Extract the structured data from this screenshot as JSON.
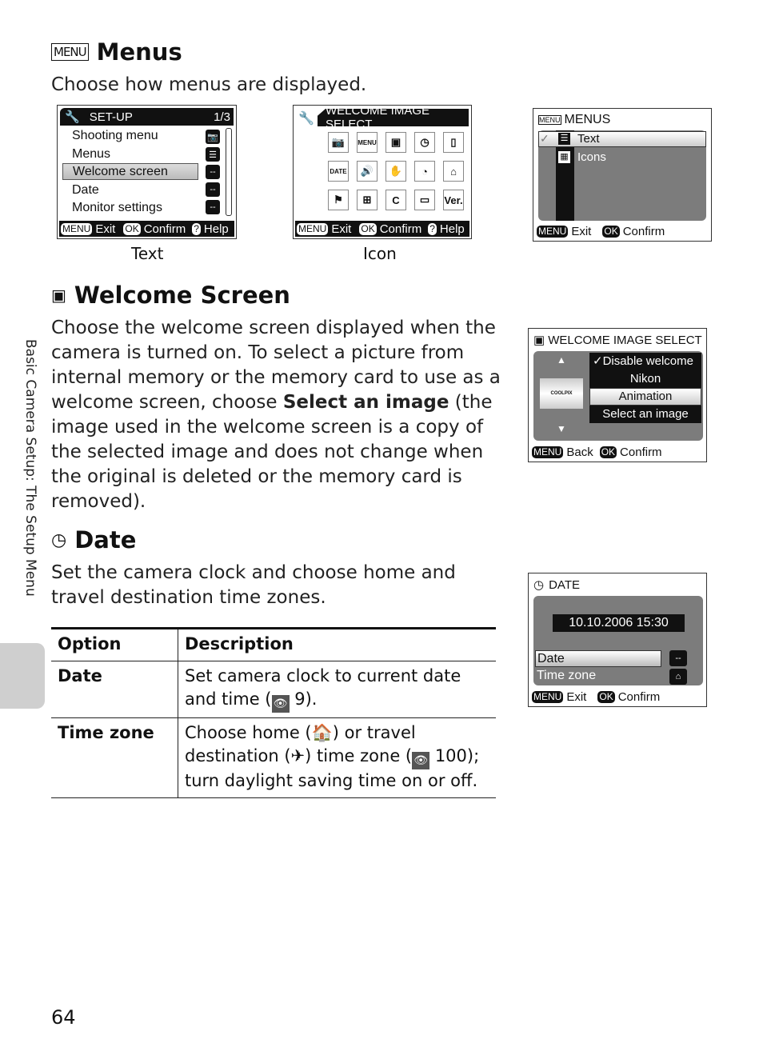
{
  "side_label": "Basic Camera Setup: The Setup Menu",
  "page_number": "64",
  "menus": {
    "icon": "menu-icon",
    "title": "Menus",
    "description": "Choose how menus are displayed.",
    "text_screen": {
      "title": "SET-UP",
      "page": "1/3",
      "items": [
        "Shooting menu",
        "Menus",
        "Welcome screen",
        "Date",
        "Monitor settings"
      ],
      "selected": "Welcome screen",
      "item_values": [
        "camera-icon",
        "list-icon",
        "--",
        "--",
        "--"
      ],
      "footer": {
        "menu_key": "MENU",
        "exit": "Exit",
        "ok_key": "OK",
        "confirm": "Confirm",
        "help_key": "?",
        "help": "Help"
      },
      "caption": "Text"
    },
    "icon_screen": {
      "title": "WELCOME IMAGE SELECT",
      "icons": [
        "shooting-menu-icon",
        "menus-icon",
        "welcome-screen-icon",
        "date-icon",
        "monitor-icon",
        "date-imprint-icon",
        "sound-icon",
        "vibration-reduction-icon",
        "auto-off-icon",
        "format-icon",
        "language-icon",
        "video-mode-icon",
        "reset-icon",
        "battery-icon",
        "firmware-version-icon"
      ],
      "icon_labels": {
        "menus": "MENU",
        "date": "DATE",
        "reset": "C",
        "version": "Ver."
      },
      "footer": {
        "menu_key": "MENU",
        "exit": "Exit",
        "ok_key": "OK",
        "confirm": "Confirm",
        "help_key": "?",
        "help": "Help"
      },
      "caption": "Icon"
    },
    "menus_screen": {
      "title": "MENUS",
      "options": [
        "Text",
        "Icons"
      ],
      "selected": "Text",
      "footer": {
        "menu_key": "MENU",
        "exit": "Exit",
        "ok_key": "OK",
        "confirm": "Confirm"
      }
    }
  },
  "welcome": {
    "title": "Welcome Screen",
    "para_before": "Choose the welcome screen displayed when the camera is turned on. To select a picture from internal memory or the memory card to use as a welcome screen, choose ",
    "para_bold": "Select an image",
    "para_after": " (the image used in the welcome screen is a copy of the selected image and does not change when the original is deleted or the memory card is removed).",
    "screen": {
      "title": "WELCOME IMAGE SELECT",
      "thumb_label": "COOLPIX",
      "options": [
        "Disable welcome",
        "Nikon",
        "Animation",
        "Select an image"
      ],
      "checked": "Disable welcome",
      "selected": "Animation",
      "footer": {
        "menu_key": "MENU",
        "back": "Back",
        "ok_key": "OK",
        "confirm": "Confirm"
      }
    }
  },
  "date": {
    "title": "Date",
    "description": "Set the camera clock and choose home and travel destination time zones.",
    "screen": {
      "title": "DATE",
      "datetime": "10.10.2006 15:30",
      "options": [
        "Date",
        "Time zone"
      ],
      "selected": "Date",
      "date_value": "--",
      "footer": {
        "menu_key": "MENU",
        "exit": "Exit",
        "ok_key": "OK",
        "confirm": "Confirm"
      }
    },
    "table": {
      "headers": [
        "Option",
        "Description"
      ],
      "rows": [
        {
          "option": "Date",
          "desc_a": "Set camera clock to current date and time (",
          "ref": "9",
          "desc_b": ")."
        },
        {
          "option": "Time zone",
          "desc_a": "Choose home (",
          "desc_b": ") or travel destination (",
          "desc_c": ") time zone (",
          "ref": "100",
          "desc_d": "); turn daylight saving time on or off."
        }
      ]
    }
  }
}
